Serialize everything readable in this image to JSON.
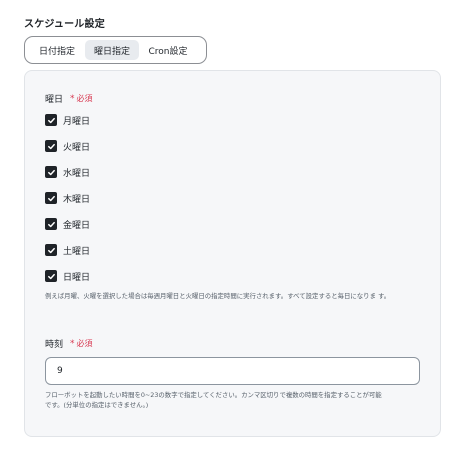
{
  "section_title": "スケジュール設定",
  "schedule_tabs": [
    {
      "label": "日付指定",
      "selected": false
    },
    {
      "label": "曜日指定",
      "selected": true
    },
    {
      "label": "Cron設定",
      "selected": false
    }
  ],
  "weekday_field": {
    "label": "曜日",
    "required_mark": "*",
    "required_text": "必須",
    "days": [
      {
        "label": "月曜日",
        "checked": true
      },
      {
        "label": "火曜日",
        "checked": true
      },
      {
        "label": "水曜日",
        "checked": true
      },
      {
        "label": "木曜日",
        "checked": true
      },
      {
        "label": "金曜日",
        "checked": true
      },
      {
        "label": "土曜日",
        "checked": true
      },
      {
        "label": "日曜日",
        "checked": true
      }
    ],
    "help": "例えば月曜、火曜を選択した場合は毎週月曜日と火曜日の指定時間に実行されます。すべて設定すると毎日になりま す。"
  },
  "time_field": {
    "label": "時刻",
    "required_mark": "*",
    "required_text": "必須",
    "value": "9",
    "help_line1": "フローボットを起動したい時間を0~23の数字で指定してください。カンマ区切りで複数の時間を指定することが可能",
    "help_line2": "です。(分単位の指定はできません。)"
  },
  "colors": {
    "required": "#d83a52",
    "checkbox": "#1f2328",
    "panel_bg": "#f6f7f9",
    "selected_tab_bg": "#e8ebef"
  }
}
